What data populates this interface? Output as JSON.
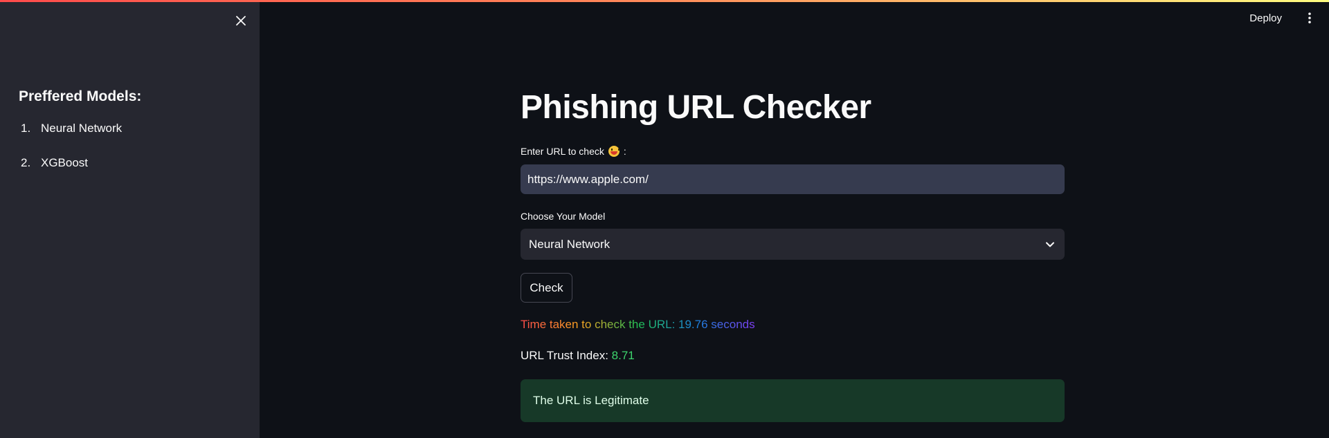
{
  "sidebar": {
    "title": "Preffered Models:",
    "models": [
      {
        "num": "1.",
        "label": "Neural Network"
      },
      {
        "num": "2.",
        "label": "XGBoost"
      }
    ]
  },
  "header": {
    "deploy_label": "Deploy"
  },
  "main": {
    "title": "Phishing URL Checker",
    "url_label": "Enter URL to check",
    "url_label_suffix": ":",
    "url_value": "https://www.apple.com/",
    "model_label": "Choose Your Model",
    "model_selected": "Neural Network",
    "check_label": "Check",
    "time_text": "Time taken to check the URL: 19.76 seconds",
    "trust_label": "URL Trust Index:",
    "trust_value": "8.71",
    "result_text": "The URL is Legitimate"
  },
  "colors": {
    "background": "#0e1117",
    "sidebar": "#262730",
    "accent": "#ff4b4b",
    "success_bg": "#173928",
    "trust_value": "#3dd56d"
  },
  "icons": {
    "close": "close-icon",
    "more": "kebab-menu-icon",
    "dropdown": "chevron-down-icon",
    "emoji": "grinning-tongue-emoji"
  }
}
